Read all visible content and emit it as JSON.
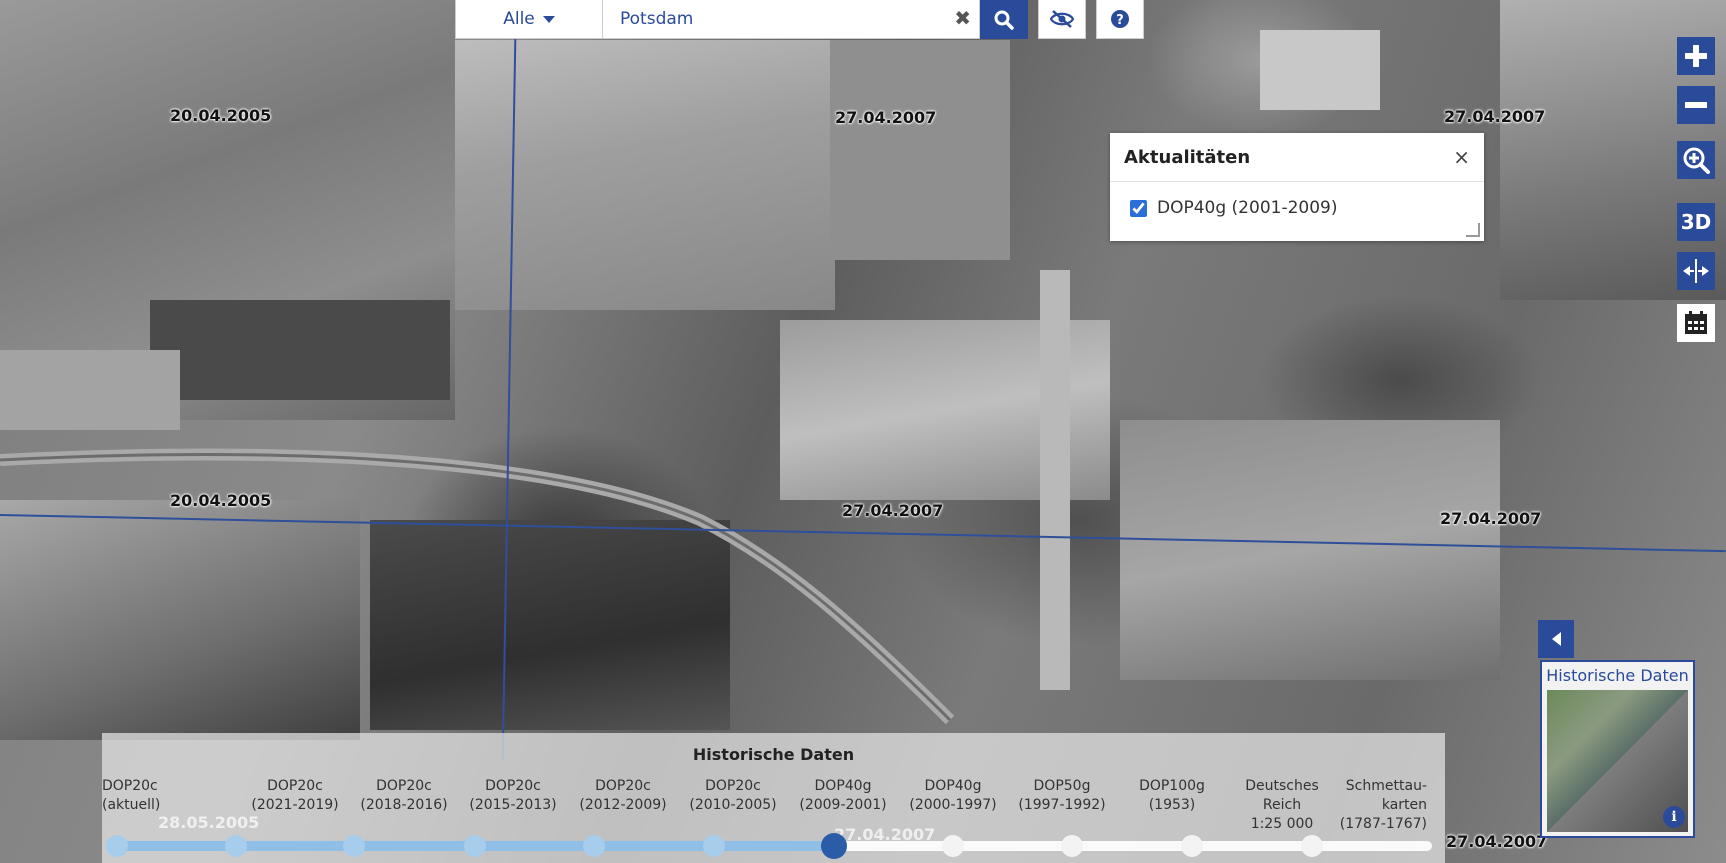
{
  "search": {
    "category_selected": "Alle",
    "query": "Potsdam",
    "clear_icon": "close-icon",
    "search_icon": "search-icon",
    "hide_icon": "eye-slash-icon",
    "help_icon": "question-circle-icon"
  },
  "toolbar": {
    "zoom_in_icon": "plus-icon",
    "zoom_out_icon": "minus-icon",
    "zoom_extent_icon": "magnifier-plus-icon",
    "three_d_label": "3D",
    "compare_icon": "split-view-icon",
    "calendar_icon": "calendar-icon"
  },
  "map": {
    "date_labels": [
      "20.04.2005",
      "27.04.2007",
      "27.04.2007",
      "20.04.2005",
      "27.04.2007",
      "27.04.2007",
      "27.04.2007",
      "28.05.2005",
      "27.04.2007"
    ]
  },
  "aktualitaeten": {
    "title": "Aktualitäten",
    "close_label": "×",
    "layer_label": "DOP40g (2001-2009)",
    "layer_checked": true
  },
  "timeline": {
    "title": "Historische Daten",
    "items": [
      {
        "label": "DOP20c\n(aktuell)"
      },
      {
        "label": "DOP20c\n(2021-2019)"
      },
      {
        "label": "DOP20c\n(2018-2016)"
      },
      {
        "label": "DOP20c\n(2015-2013)"
      },
      {
        "label": "DOP20c\n(2012-2009)"
      },
      {
        "label": "DOP20c\n(2010-2005)"
      },
      {
        "label": "DOP40g\n(2009-2001)"
      },
      {
        "label": "DOP40g\n(2000-1997)"
      },
      {
        "label": "DOP50g\n(1997-1992)"
      },
      {
        "label": "DOP100g\n(1953)"
      },
      {
        "label": "Deutsches\nReich\n1:25 000"
      },
      {
        "label": "Schmettau-\nkarten\n(1787-1767)"
      }
    ],
    "active_index": 6
  },
  "historische_panel": {
    "title": "Historische Daten",
    "toggle_icon": "caret-left-icon",
    "info_label": "i"
  }
}
